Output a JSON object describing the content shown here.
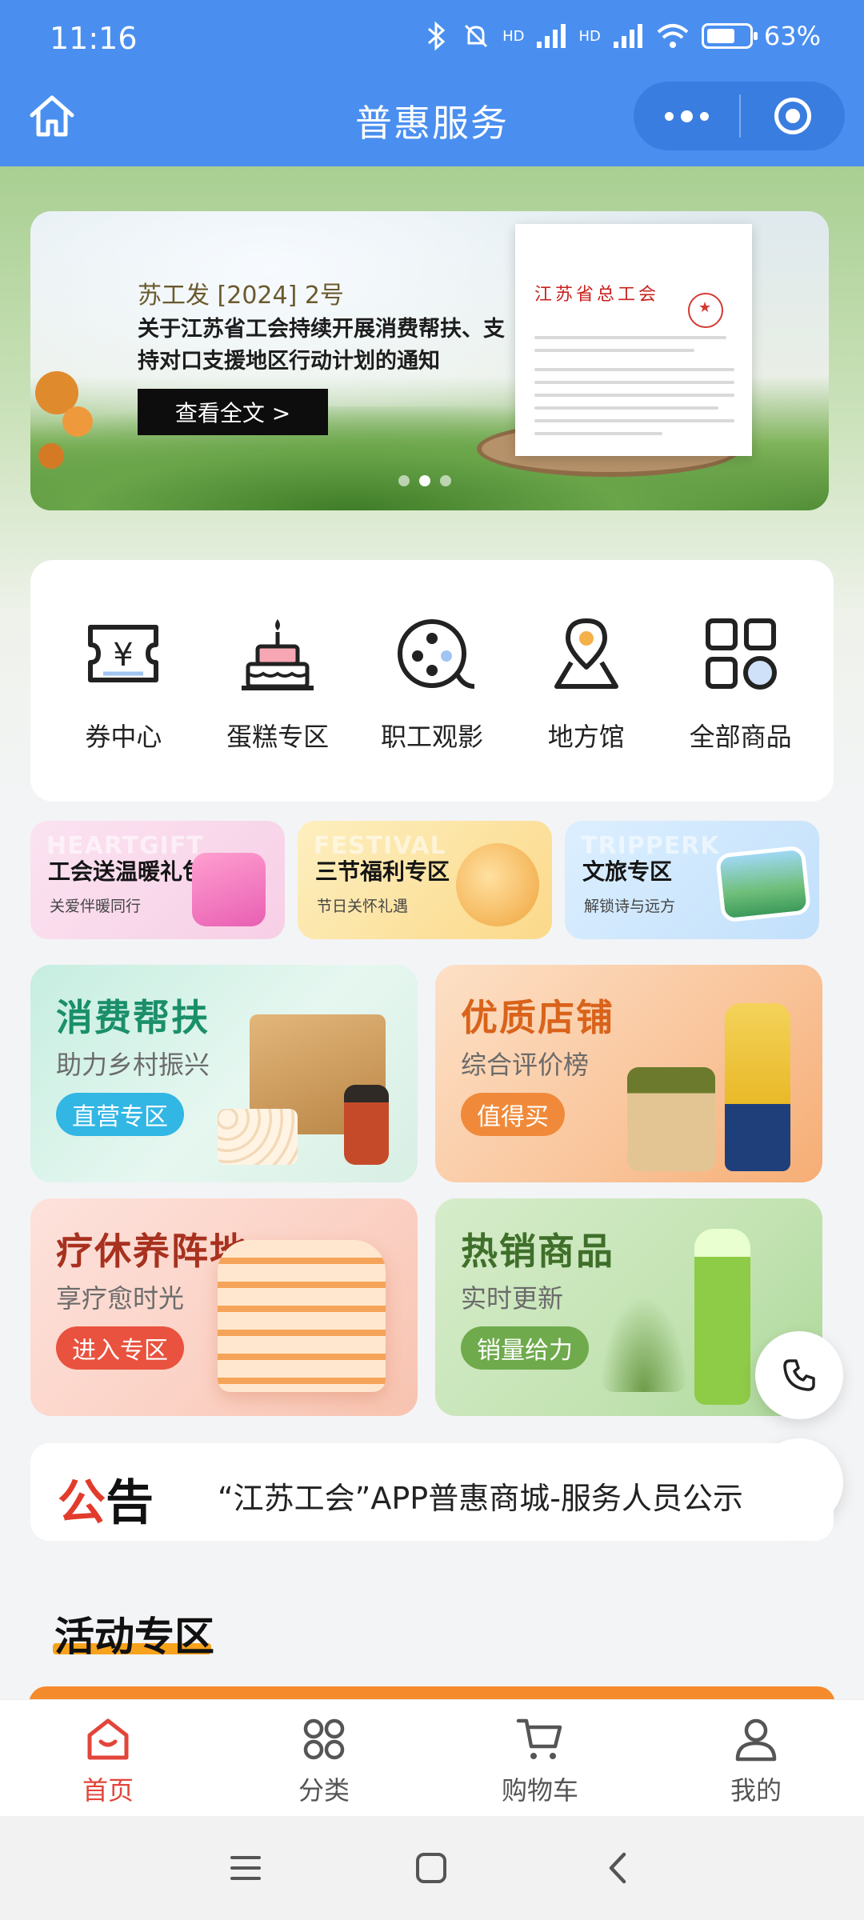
{
  "status": {
    "time": "11:16",
    "battery": "63%",
    "network1": "HD",
    "network2": "HD"
  },
  "navbar": {
    "title": "普惠服务"
  },
  "banner": {
    "subtitle": "苏工发 [2024] 2号",
    "title": "关于江苏省工会持续开展消费帮扶、支持对口支援地区行动计划的通知",
    "button": "查看全文 >",
    "doc_heading": "江苏省总工会",
    "active_slide": 2,
    "slide_count": 3
  },
  "quick": [
    {
      "label": "券中心",
      "icon": "coupon-icon"
    },
    {
      "label": "蛋糕专区",
      "icon": "cake-icon"
    },
    {
      "label": "职工观影",
      "icon": "film-reel-icon"
    },
    {
      "label": "地方馆",
      "icon": "map-pin-icon"
    },
    {
      "label": "全部商品",
      "icon": "grid-icon"
    }
  ],
  "promos": [
    {
      "en": "HEARTGIFT",
      "title": "工会送温暖礼包",
      "sub": "关爱伴暖同行",
      "color": "#f9d6ea"
    },
    {
      "en": "FESTIVAL",
      "title": "三节福利专区",
      "sub": "节日关怀礼遇",
      "color": "#fce6a6"
    },
    {
      "en": "TRIPPERK",
      "title": "文旅专区",
      "sub": "解锁诗与远方",
      "color": "#cfe7fb"
    }
  ],
  "tiles": [
    {
      "title": "消费帮扶",
      "sub": "助力乡村振兴",
      "button": "直营专区",
      "title_color": "#1a8f6a",
      "btn_color": "#32b6e4"
    },
    {
      "title": "优质店铺",
      "sub": "综合评价榜",
      "button": "值得买",
      "title_color": "#d9631b",
      "btn_color": "#f08a3a"
    },
    {
      "title": "疗休养阵地",
      "sub": "享疗愈时光",
      "button": "进入专区",
      "title_color": "#a8311f",
      "btn_color": "#e9523e"
    },
    {
      "title": "热销商品",
      "sub": "实时更新",
      "button": "销量给力",
      "title_color": "#3f6f2a",
      "btn_color": "#6faa4c"
    }
  ],
  "notice": {
    "tag_a": "公",
    "tag_b": "告",
    "text": "“江苏工会”APP普惠商城-服务人员公示"
  },
  "section": {
    "title": "活动专区"
  },
  "tabs": [
    {
      "label": "首页",
      "icon": "home-icon",
      "active": true
    },
    {
      "label": "分类",
      "icon": "category-icon",
      "active": false
    },
    {
      "label": "购物车",
      "icon": "cart-icon",
      "active": false
    },
    {
      "label": "我的",
      "icon": "user-icon",
      "active": false
    }
  ],
  "colors": {
    "primary": "#4a8ff0",
    "accent": "#e2453a"
  }
}
